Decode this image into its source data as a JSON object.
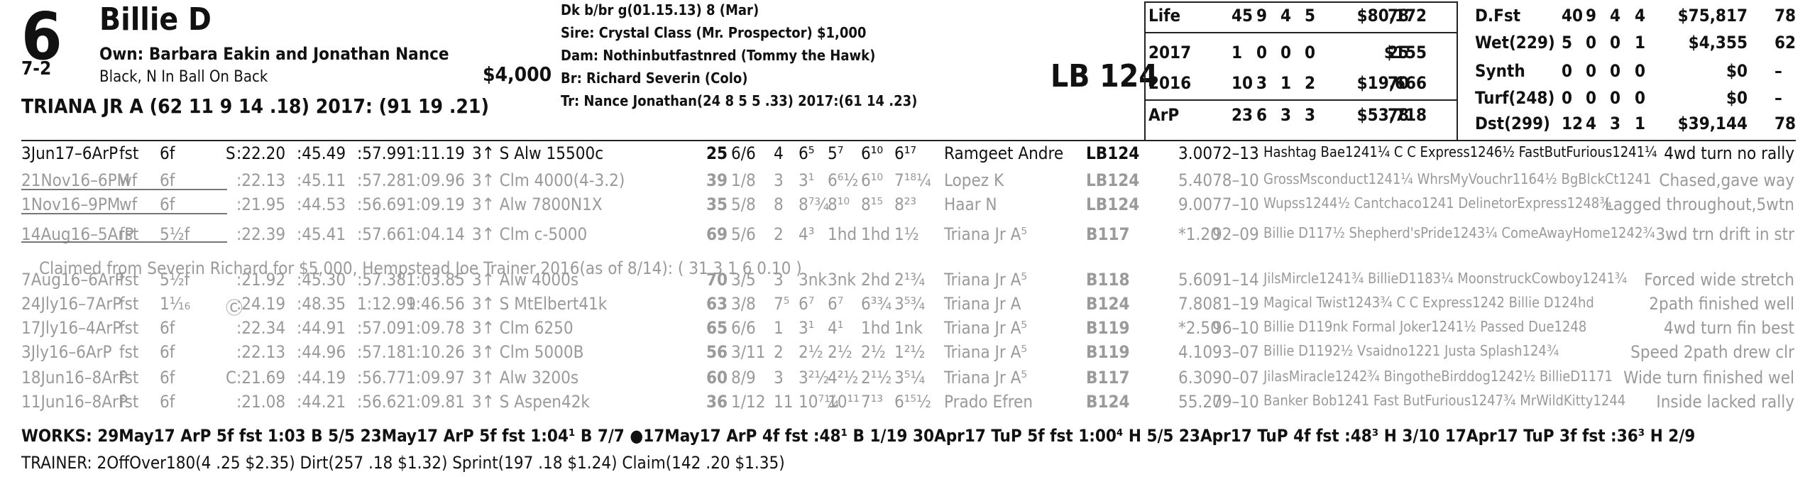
{
  "header": {
    "post_number": "6",
    "odds": "7-2",
    "horse_name": "Billie D",
    "owner": "Own: Barbara Eakin and Jonathan Nance",
    "silks": "Black, N In Ball On Back",
    "claim_price": "$4,000",
    "jockey": "TRIANA JR A (62 11 9 14 .18) 2017: (91 19 .21)",
    "weight": "LB 124"
  },
  "pedigree": {
    "line1": "Dk b/br  g(01.15.13) 8 (Mar)",
    "line2": "Sire: Crystal Class (Mr. Prospector) $1,000",
    "line3": "Dam: Nothinbutfastnred (Tommy the Hawk)",
    "line4": "Br:    Richard Severin (Colo)",
    "line5": "Tr:    Nance Jonathan(24  8  5  5  .33)  2017:(61  14  .23)"
  },
  "stats_left": [
    [
      "Life",
      "45",
      "9",
      "4",
      "5",
      "$80,172",
      "78"
    ],
    [
      "2017",
      "1",
      "0",
      "0",
      "0",
      "$155",
      "25"
    ],
    [
      "2016",
      "10",
      "3",
      "1",
      "2",
      "$19,666",
      "70"
    ],
    [
      "ArP",
      "23",
      "6",
      "3",
      "3",
      "$53,718",
      "78"
    ]
  ],
  "stats_right": [
    [
      "D.Fst",
      "40",
      "9",
      "4",
      "4",
      "$75,817",
      "78"
    ],
    [
      "Wet(229)",
      "5",
      "0",
      "0",
      "1",
      "$4,355",
      "62"
    ],
    [
      "Synth",
      "0",
      "0",
      "0",
      "0",
      "$0",
      "–"
    ],
    [
      "Turf(248)",
      "0",
      "0",
      "0",
      "0",
      "$0",
      "–"
    ],
    [
      "Dst(299)",
      "12",
      "4",
      "3",
      "1",
      "$39,144",
      "78"
    ]
  ],
  "races": [
    {
      "date": "3Jun17–6ArP",
      "trk": "fst",
      "dist": "6f",
      "s": "S",
      "f1": ":22.20",
      "f2": ":45.49",
      "f3": ":57.99",
      "fin": "1:11.19",
      "cls": "3↑ S Alw 15500c",
      "bsf": "25",
      "pp": "6/6",
      "st": "4",
      "c1": "6⁵",
      "c2": "5⁷",
      "c3": "6¹⁰",
      "c4": "6¹⁷",
      "jockey": "Ramgeet Andre",
      "med": "LB124",
      "odds": "3.00",
      "ep": "72–13",
      "comp": "Hashtag Bae1241¼ C C Express1246½ FastButFurious1241¼",
      "comment": "4wd turn no rally"
    },
    {
      "date": "21Nov16–6PM",
      "trk": "wf",
      "dist": "6f",
      "s": "",
      "f1": ":22.13",
      "f2": ":45.11",
      "f3": ":57.28",
      "fin": "1:09.96",
      "cls": "3↑ Clm 4000(4-3.2)",
      "bsf": "39",
      "pp": "1/8",
      "st": "3",
      "c1": "3¹",
      "c2": "6⁶½",
      "c3": "6¹⁰",
      "c4": "7¹⁸¼",
      "jockey": "Lopez K",
      "med": "LB124",
      "odds": "5.40",
      "ep": "78–10",
      "comp": "GrossMsconduct1241¼ WhrsMyVouchr1164½ BgBlckCt1241",
      "comment": "Chased,gave way"
    },
    {
      "date": "1Nov16–9PM",
      "trk": "wf",
      "dist": "6f",
      "s": "",
      "f1": ":21.95",
      "f2": ":44.53",
      "f3": ":56.69",
      "fin": "1:09.19",
      "cls": "3↑ Alw 7800N1X",
      "bsf": "35",
      "pp": "5/8",
      "st": "8",
      "c1": "8⁷¾",
      "c2": "8¹⁰",
      "c3": "8¹⁵",
      "c4": "8²³",
      "jockey": "Haar N",
      "med": "LB124",
      "odds": "9.00",
      "ep": "77–10",
      "comp": "Wupss1244½ Cantchaco1241 DelinetorExpress1248¾",
      "comment": "Lagged throughout,5wtn"
    },
    {
      "date": "14Aug16–5ArP",
      "trk": "fst",
      "dist": "5½f",
      "s": "",
      "f1": ":22.39",
      "f2": ":45.41",
      "f3": ":57.66",
      "fin": "1:04.14",
      "cls": "3↑ Clm c-5000",
      "bsf": "69",
      "pp": "5/6",
      "st": "2",
      "c1": "4³",
      "c2": "1hd",
      "c3": "1hd",
      "c4": "1½",
      "jockey": "Triana Jr A⁵",
      "med": "B117",
      "odds": "*1.20",
      "ep": "92–09",
      "comp": "Billie D117½ Shepherd'sPride1243¼ ComeAwayHome1242¾",
      "comment": "3wd trn drift in str"
    },
    {
      "date": "7Aug16–6ArP",
      "trk": "fst",
      "dist": "5½f",
      "s": "",
      "f1": ":21.92",
      "f2": ":45.30",
      "f3": ":57.38",
      "fin": "1:03.85",
      "cls": "3↑ Alw 4000s",
      "bsf": "70",
      "pp": "3/5",
      "st": "3",
      "c1": "3nk",
      "c2": "3nk",
      "c3": "2hd",
      "c4": "2¹¾",
      "jockey": "Triana Jr A⁵",
      "med": "B118",
      "odds": "5.60",
      "ep": "91–14",
      "comp": "JilsMircle1241¾ BillieD1183¼ MoonstruckCowboy1241¾",
      "comment": "Forced wide stretch"
    },
    {
      "date": "24Jly16–7ArP",
      "trk": "fst",
      "dist": "1¹⁄₁₆",
      "s": "Ⓒ",
      "f1": ":24.19",
      "f2": ":48.35",
      "f3": "1:12.99",
      "fin": "1:46.56",
      "cls": "3↑ S MtElbert41k",
      "bsf": "63",
      "pp": "3/8",
      "st": "7⁵",
      "c1": "6⁷",
      "c2": "6⁷",
      "c3": "6³¾",
      "c4": "3⁵¾",
      "jockey": "Triana Jr A",
      "med": "B124",
      "odds": "7.80",
      "ep": "81–19",
      "comp": "Magical Twist1243¾ C C Express1242 Billie D124hd",
      "comment": "2path finished well"
    },
    {
      "date": "17Jly16–4ArP",
      "trk": "fst",
      "dist": "6f",
      "s": "",
      "f1": ":22.34",
      "f2": ":44.91",
      "f3": ":57.09",
      "fin": "1:09.78",
      "cls": "3↑ Clm 6250",
      "bsf": "65",
      "pp": "6/6",
      "st": "1",
      "c1": "3¹",
      "c2": "4¹",
      "c3": "1hd",
      "c4": "1nk",
      "jockey": "Triana Jr A⁵",
      "med": "B119",
      "odds": "*2.50",
      "ep": "96–10",
      "comp": "Billie D119nk Formal Joker1241½ Passed Due1248",
      "comment": "4wd turn fin best"
    },
    {
      "date": "3Jly16–6ArP",
      "trk": "fst",
      "dist": "6f",
      "s": "",
      "f1": ":22.13",
      "f2": ":44.96",
      "f3": ":57.18",
      "fin": "1:10.26",
      "cls": "3↑ Clm 5000B",
      "bsf": "56",
      "pp": "3/11",
      "st": "2",
      "c1": "2½",
      "c2": "2½",
      "c3": "2½",
      "c4": "1²½",
      "jockey": "Triana Jr A⁵",
      "med": "B119",
      "odds": "4.10",
      "ep": "93–07",
      "comp": "Billie D1192½ Vsaidno1221 Justa Splash124¾",
      "comment": "Speed 2path drew clr"
    },
    {
      "date": "18Jun16–8ArP",
      "trk": "fst",
      "dist": "6f",
      "s": "C",
      "f1": ":21.69",
      "f2": ":44.19",
      "f3": ":56.77",
      "fin": "1:09.97",
      "cls": "3↑ Alw 3200s",
      "bsf": "60",
      "pp": "8/9",
      "st": "3",
      "c1": "3²½",
      "c2": "4²½",
      "c3": "2¹½",
      "c4": "3⁵¼",
      "jockey": "Triana Jr A⁵",
      "med": "B117",
      "odds": "6.30",
      "ep": "90–07",
      "comp": "JilasMiracle1242¾ BingotheBirddog1242½ BillieD1171",
      "comment": "Wide turn finished wel"
    },
    {
      "date": "11Jun16–8ArP",
      "trk": "fst",
      "dist": "6f",
      "s": "",
      "f1": ":21.08",
      "f2": ":44.21",
      "f3": ":56.62",
      "fin": "1:09.81",
      "cls": "3↑ S Aspen42k",
      "bsf": "36",
      "pp": "1/12",
      "st": "11",
      "c1": "10⁷¼",
      "c2": "10¹¹",
      "c3": "7¹³",
      "c4": "6¹⁵½",
      "jockey": "Prado Efren",
      "med": "B124",
      "odds": "55.20",
      "ep": "79–10",
      "comp": "Banker Bob1241 Fast ButFurious1247¾ MrWildKitty1244",
      "comment": "Inside lacked rally"
    }
  ],
  "claim_note": "Claimed from Severin Richard  for $5,000, Hempstead Joe  Trainer 2016(as of 8/14): ( 31  3  1  6  0.10 )",
  "works": "WORKS:    29May17 ArP 5f fst 1:03 B 5/5    23May17 ArP 5f fst 1:04¹ B 7/7    ●17May17 ArP 4f fst :48¹ B 1/19    30Apr17 TuP 5f fst 1:00⁴ H 5/5    23Apr17 TuP 4f fst :48³ H 3/10    17Apr17 TuP 3f fst :36³ H 2/9",
  "trainer": "TRAINER: 2OffOver180(4 .25 $2.35) Dirt(257 .18 $1.32) Sprint(197 .18 $1.24) Claim(142 .20 $1.35)"
}
